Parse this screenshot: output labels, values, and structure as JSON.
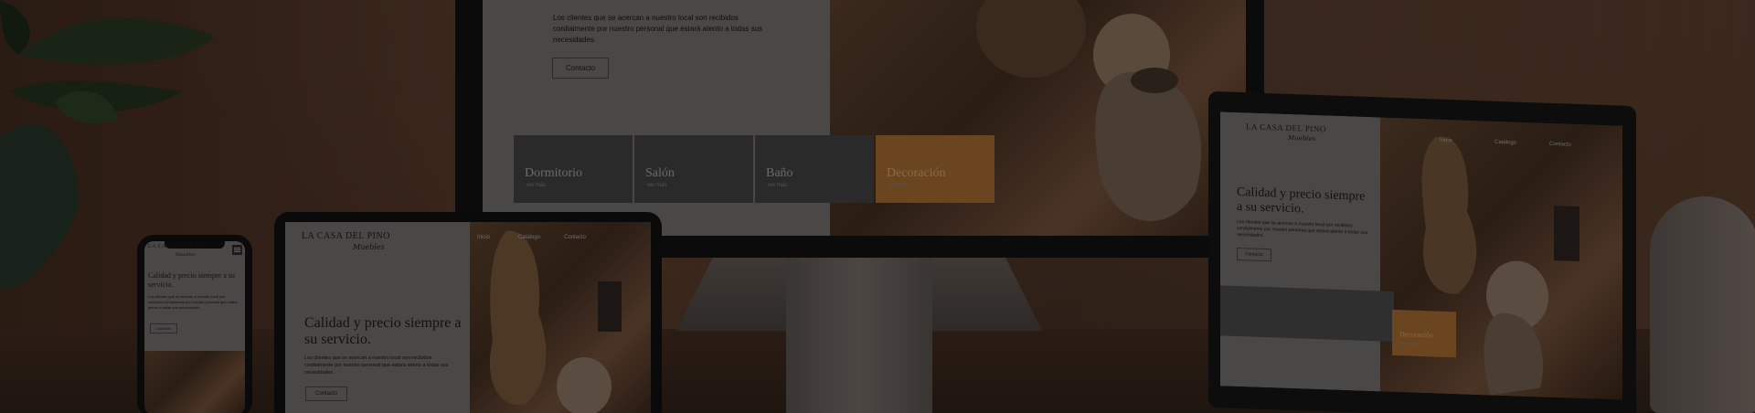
{
  "monitor": {
    "body_text": "Los clientes que se acercan a nuestro local son recibidos cordialmente por nuestro personal que estará atento a todas sus necesidades.",
    "button": "Contacto",
    "categories": [
      {
        "label": "Dormitorio",
        "more": "ver más"
      },
      {
        "label": "Salón",
        "more": "ver más"
      },
      {
        "label": "Baño",
        "more": "ver más"
      },
      {
        "label": "Decoración",
        "more": "ver más"
      }
    ]
  },
  "brand": {
    "name": "LA CASA DEL PINO",
    "tagline": "Muebles"
  },
  "hero": {
    "heading": "Calidad y precio siempre a su servicio.",
    "body_text": "Los clientes que se acercan a nuestro local son recibidos cordialmente por nuestro personal que estará atento a todas sus necesidades.",
    "button": "Contacto"
  },
  "nav": {
    "items": [
      "Inicio",
      "Catálogo",
      "Contacto"
    ]
  },
  "laptop": {
    "decor_label": "Decoración",
    "decor_more": "ver más"
  },
  "colors": {
    "accent": "#b07a3c",
    "dark": "#0b0b0b",
    "panel": "#4a4847"
  },
  "icons": {
    "menu": "hamburger-icon"
  }
}
